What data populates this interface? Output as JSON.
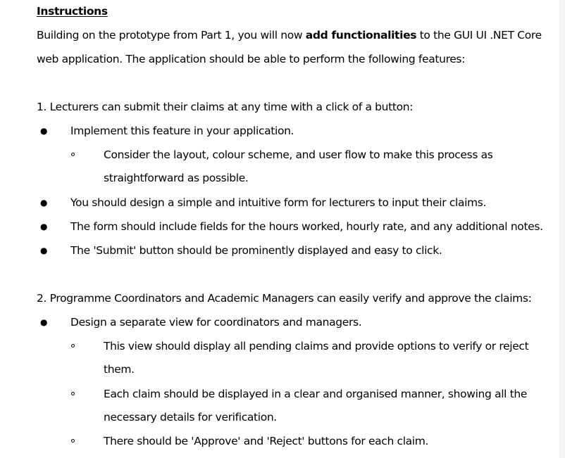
{
  "document": {
    "heading": "Instructions",
    "intro": {
      "before": "Building on the prototype from Part 1, you will now ",
      "emphasis": "add functionalities",
      "after": " to the GUI UI .NET Core",
      "line2": "web application. The application should be able to perform the following features:"
    },
    "section1": {
      "title": "1. Lecturers can submit their claims at any time with a click of a button:",
      "bullets": [
        "Implement this feature in your application.",
        "You should design a simple and intuitive form for lecturers to input their claims.",
        "The form should include fields for the hours worked, hourly rate, and any additional notes.",
        "The 'Submit' button should be prominently displayed and easy to click."
      ],
      "sub_bullets": [
        {
          "line1": "Consider the layout, colour scheme, and user flow to make this process as",
          "line2": "straightforward as possible."
        }
      ]
    },
    "section2": {
      "title": "2. Programme Coordinators and Academic Managers can easily verify and approve the claims:",
      "bullets": [
        "Design a separate view for coordinators and managers."
      ],
      "sub_bullets": [
        {
          "line1": "This view should display all pending claims and provide options to verify or reject",
          "line2": "them."
        },
        {
          "line1": "Each claim should be displayed in a clear and organised manner, showing all the",
          "line2": "necessary details for verification."
        },
        {
          "line1": "There should be 'Approve' and 'Reject' buttons for each claim."
        }
      ]
    }
  }
}
